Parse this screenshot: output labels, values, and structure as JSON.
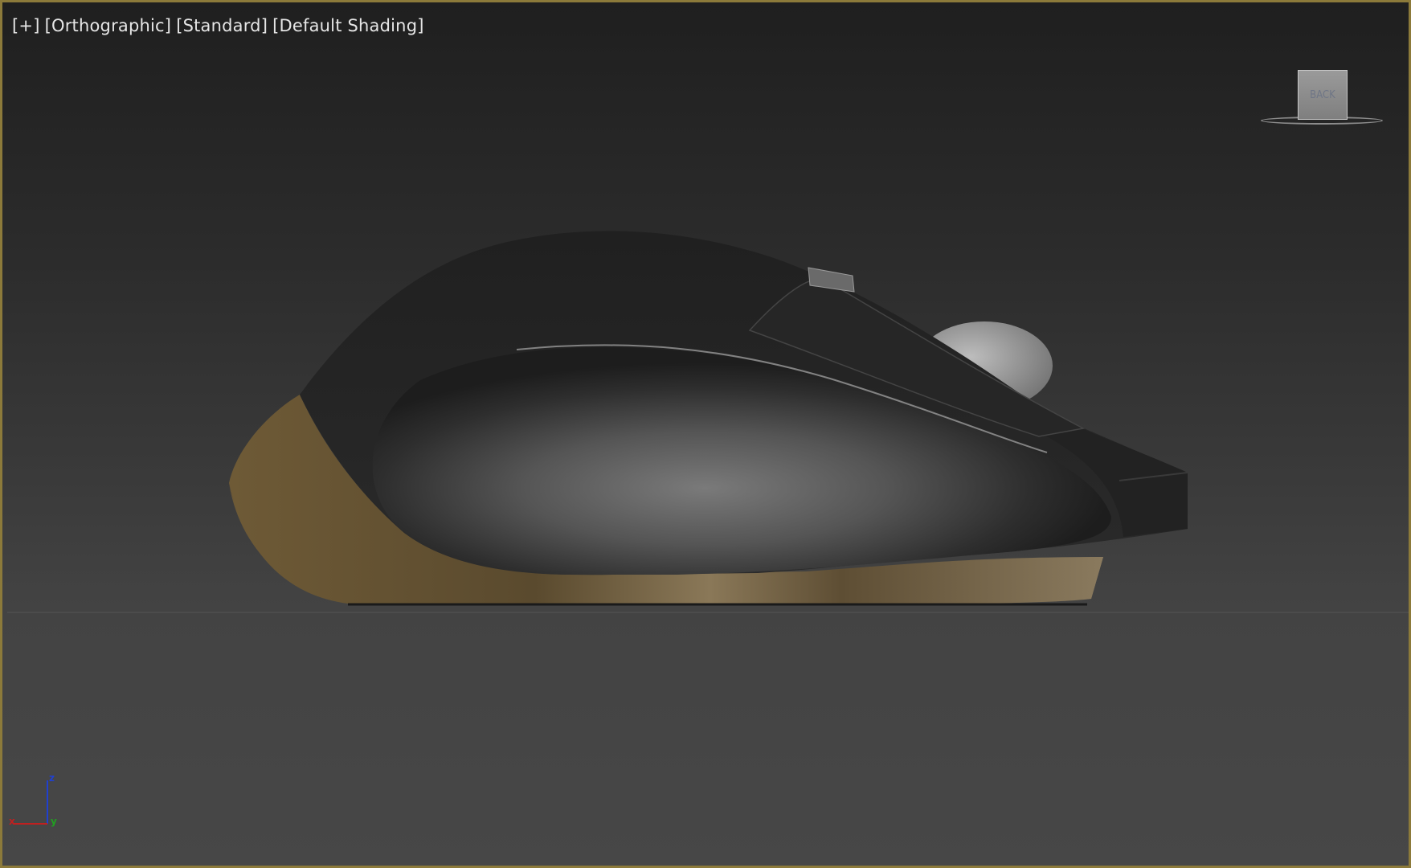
{
  "viewport": {
    "labels": [
      "[+]",
      "[Orthographic]",
      "[Standard]",
      "[Default Shading]"
    ],
    "viewcube_face": "BACK",
    "border_color": "#8c7a3a"
  },
  "axes": {
    "z": "z",
    "x": "x",
    "y": "y"
  },
  "colors": {
    "body": "#222222",
    "accent": "#6b5738",
    "wheel": "#a0a0a0",
    "axis_x": "#c02020",
    "axis_y": "#20a020",
    "axis_z": "#2040d0"
  },
  "icons": [
    "viewcube-icon",
    "axis-tripod-icon"
  ]
}
